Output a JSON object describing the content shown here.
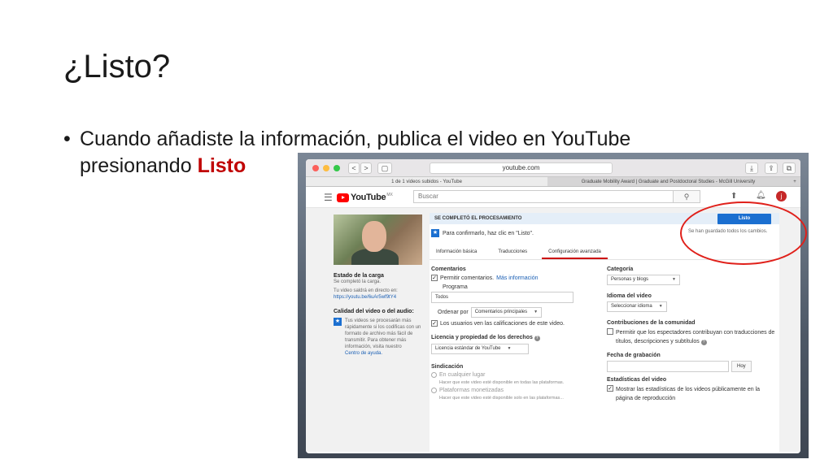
{
  "slide": {
    "title": "¿Listo?",
    "bullet_bullet": "•",
    "bullet_text": "Cuando añadiste la información, publica el video en YouTube presionando ",
    "bullet_highlight": "Listo"
  },
  "browser": {
    "nav_back": "<",
    "nav_fwd": ">",
    "sidebar_glyph": "▢",
    "address": "youtube.com",
    "tabs": [
      "1 de 1 videos subidos - YouTube",
      "Graduate Mobility Award | Graduate and Postdoctoral Studies - McGill University"
    ],
    "tab_plus": "+"
  },
  "youtube": {
    "logo_text": "YouTube",
    "logo_region": "MX",
    "search_placeholder": "Buscar",
    "avatar_letter": "j"
  },
  "left_panel": {
    "upload_status_title": "Estado de la carga",
    "upload_status_text": "Se completó la carga.",
    "video_link_text": "Tu video saldrá en directo en:",
    "video_link": "https://youtu.be/6uAr5wf9tY4",
    "quality_title": "Calidad del video o del audio:",
    "quality_text": "Tus videos se procesarán más rápidamente si los codificas con un formato de archivo más fácil de transmitir. Para obtener más información, visita nuestro",
    "help_center": "Centro de ayuda."
  },
  "main": {
    "banner": "SE COMPLETÓ EL PROCESAMIENTO",
    "listo_button": "Listo",
    "confirm_text": "Para confirmarlo, haz clic en \"Listo\".",
    "saved_text": "Se han guardado todos los cambios.",
    "subtabs": [
      "Información básica",
      "Traducciones",
      "Configuración avanzada"
    ],
    "comments_title": "Comentarios",
    "allow_comments": "Permitir comentarios.",
    "more_info": "Más información",
    "program_label": "Programa",
    "program_value": "Todos",
    "order_label": "Ordenar por",
    "order_value": "Comentarios principales",
    "users_ratings": "Los usuarios ven las calificaciones de este video.",
    "license_title": "Licencia y propiedad de los derechos",
    "license_value": "Licencia estándar de YouTube",
    "syndication_title": "Sindicación",
    "synd_opt1": "En cualquier lugar",
    "synd_opt1_desc": "Hacer que este video esté disponible en todas las plataformas.",
    "synd_opt2": "Plataformas monetizadas",
    "synd_opt2_desc": "Hacer que este video esté disponible solo en las plataformas...",
    "category_title": "Categoría",
    "category_value": "Personas y blogs",
    "language_title": "Idioma del video",
    "language_value": "Seleccionar idioma",
    "community_title": "Contribuciones de la comunidad",
    "community_text": "Permitir que los espectadores contribuyan con traducciones de títulos, descripciones y subtítulos",
    "recording_title": "Fecha de grabación",
    "today_button": "Hoy",
    "stats_title": "Estadísticas del video",
    "stats_text": "Mostrar las estadísticas de los videos públicamente en la página de reproducción"
  },
  "colors": {
    "highlight": "#c00000",
    "youtube_red": "#ff0000",
    "button_blue": "#1b6fd0",
    "annotation": "#e0201a"
  }
}
